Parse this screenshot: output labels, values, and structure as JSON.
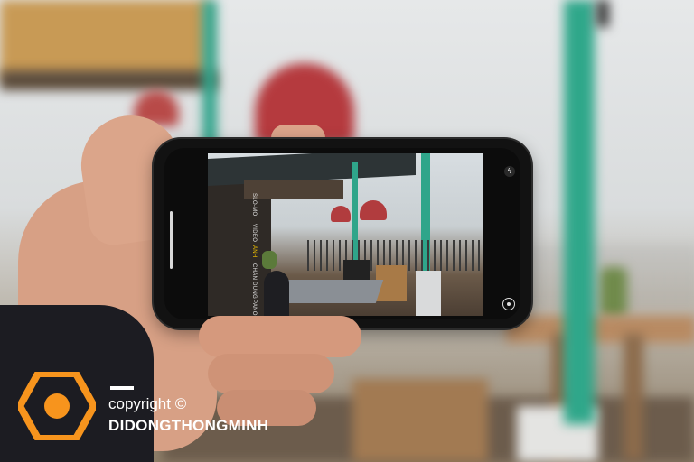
{
  "camera": {
    "modes": [
      "SLO-MO",
      "VIDEO",
      "ẢNH",
      "CHÂN DUNG",
      "PANO"
    ],
    "active_mode": "ẢNH",
    "icons": {
      "flash": "flash-icon",
      "flip": "camera-flip-icon",
      "live": "live-photo-icon",
      "shutter": "shutter-button",
      "thumbnail": "photo-thumbnail"
    }
  },
  "watermark": {
    "copyright": "copyright ©",
    "brand": "DIDONGTHONGMINH",
    "logo": "hexagon-logo",
    "accent": "#f7941d"
  }
}
